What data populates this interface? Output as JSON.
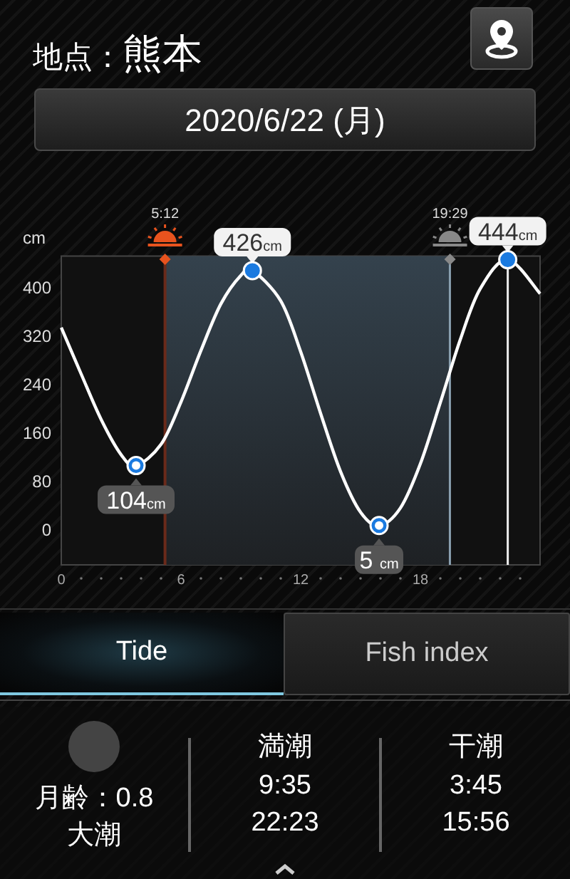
{
  "header": {
    "location_label": "地点：",
    "location": "熊本"
  },
  "date": "2020/6/22 (月)",
  "chart": {
    "sunrise": {
      "time": "5:12"
    },
    "sunset": {
      "time": "19:29"
    },
    "chart_data": {
      "type": "line",
      "ylabel": "cm",
      "xlim": [
        0,
        24
      ],
      "ylim": [
        -60,
        450
      ],
      "xticks": [
        0,
        6,
        12,
        18
      ],
      "yticks": [
        0,
        80,
        160,
        240,
        320,
        400
      ],
      "x": [
        0,
        1,
        2,
        3,
        3.75,
        5,
        6,
        7,
        8,
        9,
        9.58,
        11,
        12,
        13,
        14,
        15,
        15.93,
        17,
        18,
        19,
        20,
        21,
        22.38,
        24
      ],
      "bands": [
        {
          "axis": "x",
          "from": 5.2,
          "to": 19.48,
          "color": "#34424d"
        }
      ],
      "ref_lines": [
        {
          "axis": "x",
          "value": 5.2,
          "color": "#6a2a1a"
        },
        {
          "axis": "x",
          "value": 19.48,
          "color": "#8aa0b0"
        },
        {
          "axis": "x",
          "value": 22.38,
          "color": "#eeeeee"
        }
      ],
      "series": [
        {
          "color": "#ffffff",
          "values": [
            332,
            255,
            180,
            122,
            104,
            139,
            209,
            294,
            371,
            418,
            426,
            376,
            292,
            190,
            94,
            27,
            5,
            34,
            107,
            208,
            312,
            396,
            444,
            388
          ]
        }
      ],
      "annotations": [
        {
          "x": 3.75,
          "y": 104,
          "text": "104cm"
        },
        {
          "x": 9.58,
          "y": 426,
          "text": "426cm"
        },
        {
          "x": 15.93,
          "y": 5,
          "text": "5 cm"
        },
        {
          "x": 22.38,
          "y": 444,
          "text": "444cm"
        }
      ]
    }
  },
  "tabs": [
    {
      "label": "Tide",
      "selected": true
    },
    {
      "label": "Fish index",
      "selected": false
    }
  ],
  "summary": {
    "moon_age": "月齢：0.8",
    "tide_type": "大潮",
    "columns": [
      {
        "heading": "満潮",
        "times": [
          "9:35",
          "22:23"
        ]
      },
      {
        "heading": "干潮",
        "times": [
          "3:45",
          "15:56"
        ]
      }
    ]
  }
}
